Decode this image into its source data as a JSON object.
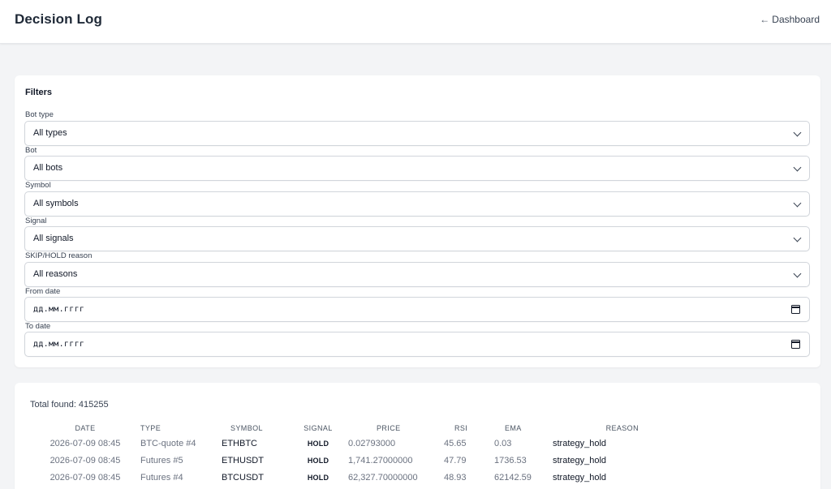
{
  "header": {
    "title": "Decision Log",
    "back_arrow": "←",
    "back_label": "Dashboard"
  },
  "filters": {
    "title": "Filters",
    "fields": [
      {
        "label": "Bot type",
        "value": "All types",
        "kind": "select"
      },
      {
        "label": "Bot",
        "value": "All bots",
        "kind": "select"
      },
      {
        "label": "Symbol",
        "value": "All symbols",
        "kind": "select"
      },
      {
        "label": "Signal",
        "value": "All signals",
        "kind": "select"
      },
      {
        "label": "SKIP/HOLD reason",
        "value": "All reasons",
        "kind": "select"
      },
      {
        "label": "From date",
        "value": "дд.мм.гггг",
        "kind": "date"
      },
      {
        "label": "To date",
        "value": "дд.мм.гггг",
        "kind": "date"
      }
    ]
  },
  "results": {
    "total_found": "Total found: 415255",
    "columns": [
      "Date",
      "Type",
      "Symbol",
      "Signal",
      "Price",
      "RSI",
      "EMA",
      "Reason"
    ],
    "rows": [
      {
        "date": "2026-07-09 08:45",
        "type": "BTC-quote #4",
        "symbol": "ETHBTC",
        "signal": "HOLD",
        "price": "0.02793000",
        "rsi": "45.65",
        "ema": "0.03",
        "reason": "strategy_hold"
      },
      {
        "date": "2026-07-09 08:45",
        "type": "Futures #5",
        "symbol": "ETHUSDT",
        "signal": "HOLD",
        "price": "1,741.27000000",
        "rsi": "47.79",
        "ema": "1736.53",
        "reason": "strategy_hold"
      },
      {
        "date": "2026-07-09 08:45",
        "type": "Futures #4",
        "symbol": "BTCUSDT",
        "signal": "HOLD",
        "price": "62,327.70000000",
        "rsi": "48.93",
        "ema": "62142.59",
        "reason": "strategy_hold"
      }
    ]
  }
}
